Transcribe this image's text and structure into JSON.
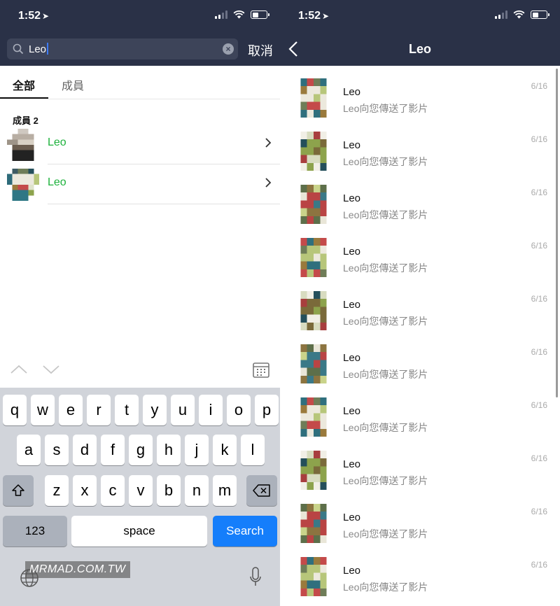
{
  "status": {
    "time": "1:52",
    "location_glyph": "➤"
  },
  "left": {
    "search": {
      "value": "Leo",
      "clear_label": "×"
    },
    "cancel_label": "取消",
    "tabs": [
      {
        "label": "全部"
      },
      {
        "label": "成員"
      }
    ],
    "section_title": "成員 2",
    "members": [
      {
        "name": "Leo"
      },
      {
        "name": "Leo"
      }
    ],
    "keyboard": {
      "row1": [
        "q",
        "w",
        "e",
        "r",
        "t",
        "y",
        "u",
        "i",
        "o",
        "p"
      ],
      "row2": [
        "a",
        "s",
        "d",
        "f",
        "g",
        "h",
        "j",
        "k",
        "l"
      ],
      "row3": [
        "z",
        "x",
        "c",
        "v",
        "b",
        "n",
        "m"
      ],
      "numbers_label": "123",
      "space_label": "space",
      "search_label": "Search"
    },
    "watermark": "MRMAD.COM.TW"
  },
  "right": {
    "title": "Leo",
    "chats": [
      {
        "name": "Leo",
        "message": "Leo向您傳送了影片",
        "date": "6/16"
      },
      {
        "name": "Leo",
        "message": "Leo向您傳送了影片",
        "date": "6/16"
      },
      {
        "name": "Leo",
        "message": "Leo向您傳送了影片",
        "date": "6/16"
      },
      {
        "name": "Leo",
        "message": "Leo向您傳送了影片",
        "date": "6/16"
      },
      {
        "name": "Leo",
        "message": "Leo向您傳送了影片",
        "date": "6/16"
      },
      {
        "name": "Leo",
        "message": "Leo向您傳送了影片",
        "date": "6/16"
      },
      {
        "name": "Leo",
        "message": "Leo向您傳送了影片",
        "date": "6/16"
      },
      {
        "name": "Leo",
        "message": "Leo向您傳送了影片",
        "date": "6/16"
      },
      {
        "name": "Leo",
        "message": "Leo向您傳送了影片",
        "date": "6/16"
      },
      {
        "name": "Leo",
        "message": "Leo向您傳送了影片",
        "date": "6/16"
      }
    ]
  },
  "colors": {
    "header": "#2a3147",
    "member_name": "#1db23c",
    "search_key": "#157efb"
  },
  "icons": [
    "search-icon",
    "clear-icon",
    "back-icon",
    "chevron-right-icon",
    "chevron-up-icon",
    "chevron-down-icon",
    "calendar-icon",
    "shift-icon",
    "backspace-icon",
    "globe-icon",
    "mic-icon",
    "wifi-icon",
    "signal-icon",
    "battery-icon"
  ]
}
